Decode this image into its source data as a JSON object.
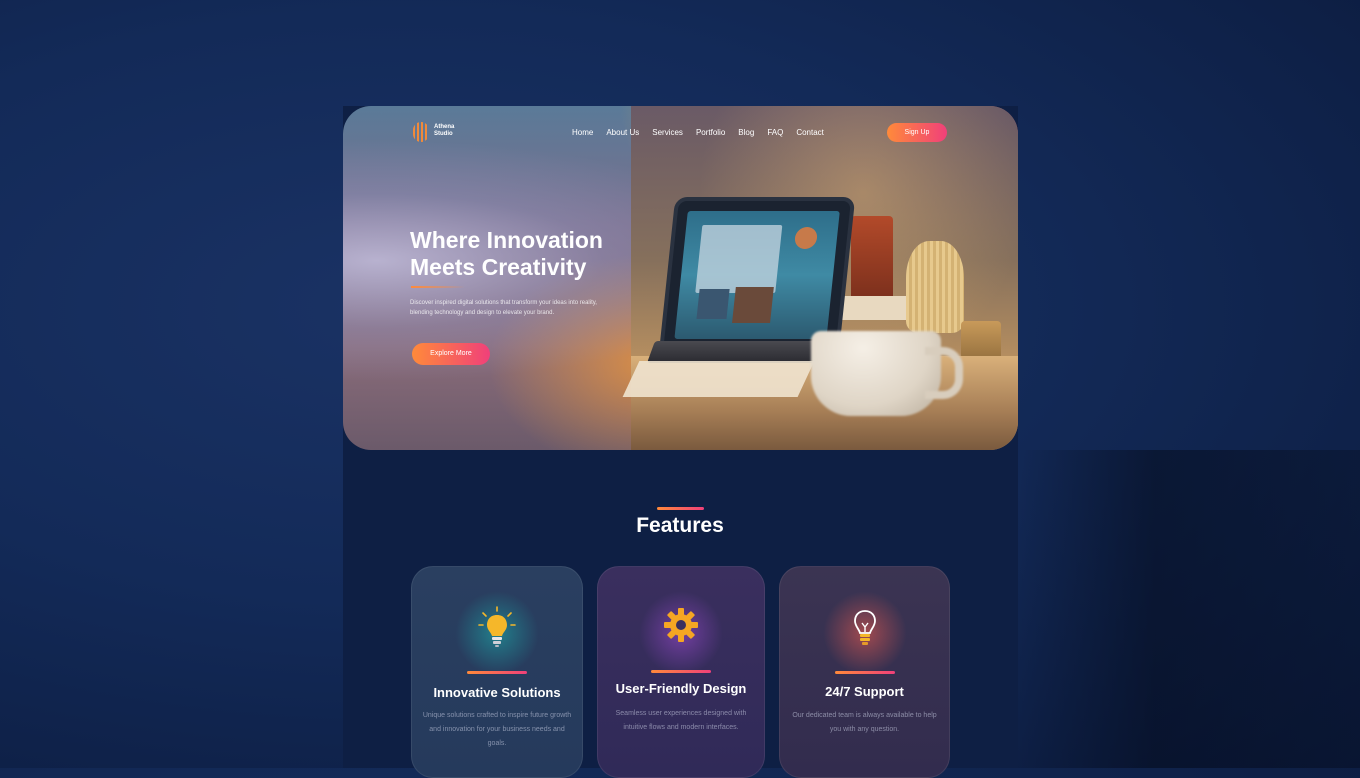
{
  "brand": {
    "name": "Athena Studio",
    "accent_start": "#ff8a3a",
    "accent_end": "#f0407a"
  },
  "nav": {
    "links": [
      "Home",
      "About Us",
      "Services",
      "Portfolio",
      "Blog",
      "FAQ",
      "Contact"
    ],
    "signup_label": "Sign Up"
  },
  "hero": {
    "title_line1": "Where Innovation",
    "title_line2": "Meets Creativity",
    "description": "Discover inspired digital solutions that transform your ideas into reality, blending technology and design to elevate your brand.",
    "cta_label": "Explore More",
    "image": "laptop-desk-workspace-photo"
  },
  "features": {
    "title": "Features",
    "cards": [
      {
        "title": "Innovative Solutions",
        "icon": "lightbulb-glowing-icon",
        "description": "Unique solutions crafted to inspire future growth and innovation for your business needs and goals."
      },
      {
        "title": "User-Friendly Design",
        "icon": "gear-icon",
        "description": "Seamless user experiences designed with intuitive flows and modern interfaces."
      },
      {
        "title": "24/7 Support",
        "icon": "lightbulb-outline-icon",
        "description": "Our dedicated team is always available to help you with any question."
      }
    ]
  }
}
